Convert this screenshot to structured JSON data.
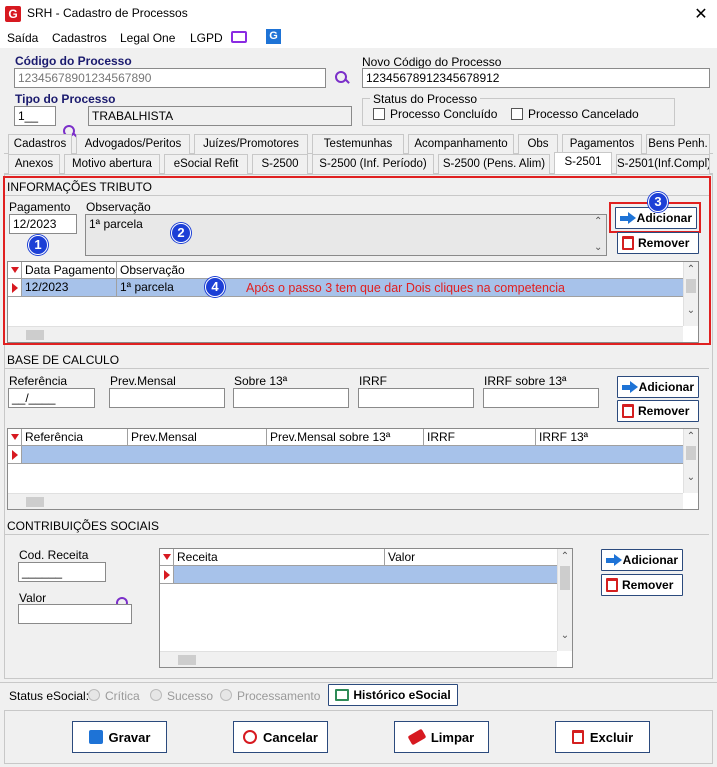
{
  "window": {
    "title": "SRH - Cadastro de Processos",
    "close": "✕"
  },
  "menu": [
    "Saída",
    "Cadastros",
    "Legal One",
    "LGPD"
  ],
  "header": {
    "codigo_label": "Código do Processo",
    "codigo_value": "12345678901234567890",
    "novo_codigo_label": "Novo Código do Processo",
    "novo_codigo_value": "12345678912345678912",
    "tipo_label": "Tipo do Processo",
    "tipo_code": "1__",
    "tipo_value": "TRABALHISTA",
    "status_label": "Status do Processo",
    "concluido_label": "Processo Concluído",
    "cancelado_label": "Processo Cancelado"
  },
  "tabs_row1": [
    "Cadastros",
    "Advogados/Peritos",
    "Juízes/Promotores",
    "Testemunhas",
    "Acompanhamento",
    "Obs",
    "Pagamentos",
    "Bens Penh."
  ],
  "tabs_row2": [
    "Anexos",
    "Motivo abertura",
    "eSocial Refit",
    "S-2500",
    "S-2500 (Inf. Período)",
    "S-2500 (Pens. Alim)",
    "S-2501",
    "S-2501(Inf.Compl)"
  ],
  "info_tributo": {
    "title": "INFORMAÇÕES TRIBUTO",
    "pagamento_label": "Pagamento",
    "pagamento_value": "12/2023",
    "observacao_label": "Observação",
    "observacao_value": "1ª parcela",
    "add_label": "Adicionar",
    "remove_label": "Remover",
    "grid_headers": [
      "Data Pagamento",
      "Observação"
    ],
    "grid_row": [
      "12/2023",
      "1ª parcela"
    ],
    "annotation": "Após o passo 3 tem que dar Dois cliques na competencia"
  },
  "callouts": [
    "1",
    "2",
    "3",
    "4"
  ],
  "base_calculo": {
    "title": "BASE DE CALCULO",
    "referencia_label": "Referência",
    "referencia_value": "__/____",
    "prev_mensal_label": "Prev.Mensal",
    "sobre13_label": "Sobre 13ª",
    "irrf_label": "IRRF",
    "irrf13_label": "IRRF sobre  13ª",
    "add_label": "Adicionar",
    "remove_label": "Remover",
    "grid_headers": [
      "Referência",
      "Prev.Mensal",
      "Prev.Mensal sobre 13ª",
      "IRRF",
      "IRRF 13ª"
    ]
  },
  "contribuicoes": {
    "title": "CONTRIBUIÇÕES SOCIAIS",
    "cod_label": "Cod. Receita",
    "cod_value": "______",
    "valor_label": "Valor",
    "grid_headers": [
      "Receita",
      "Valor"
    ],
    "add_label": "Adicionar",
    "remove_label": "Remover"
  },
  "status_esocial": {
    "label": "Status eSocial:",
    "options": [
      "Crítica",
      "Sucesso",
      "Processamento"
    ],
    "historico": "Histórico eSocial"
  },
  "footer": {
    "gravar": "Gravar",
    "cancelar": "Cancelar",
    "limpar": "Limpar",
    "excluir": "Excluir"
  },
  "colors": {
    "accent": "#1c3fd6",
    "red": "#e02020",
    "selection": "#a7c2ea"
  }
}
